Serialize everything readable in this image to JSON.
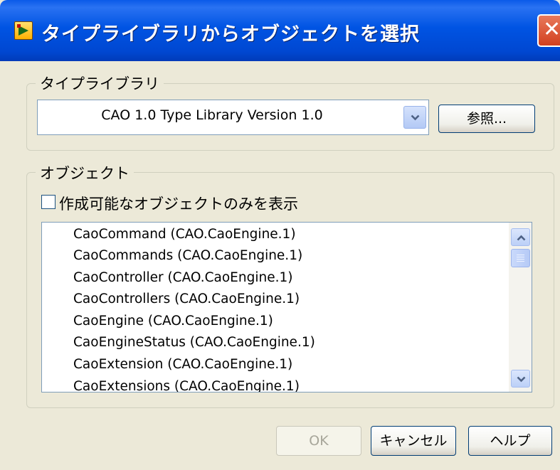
{
  "window": {
    "title": "タイプライブラリからオブジェクトを選択"
  },
  "type_library": {
    "group_label": "タイプライブラリ",
    "selected": "CAO 1.0 Type Library Version 1.0",
    "browse_label": "参照..."
  },
  "objects": {
    "group_label": "オブジェクト",
    "checkbox_label": "作成可能なオブジェクトのみを表示",
    "checkbox_checked": false,
    "items": [
      "CaoCommand (CAO.CaoEngine.1)",
      "CaoCommands (CAO.CaoEngine.1)",
      "CaoController (CAO.CaoEngine.1)",
      "CaoControllers (CAO.CaoEngine.1)",
      "CaoEngine (CAO.CaoEngine.1)",
      "CaoEngineStatus (CAO.CaoEngine.1)",
      "CaoExtension (CAO.CaoEngine.1)",
      "CaoExtensions (CAO.CaoEngine.1)"
    ]
  },
  "buttons": {
    "ok": "OK",
    "cancel": "キャンセル",
    "help": "ヘルプ"
  },
  "colors": {
    "titlebar": "#0054e3",
    "dialog_bg": "#ece9d8",
    "close": "#d2401f"
  },
  "icons": [
    "app-icon",
    "close-icon",
    "dropdown-arrow-icon",
    "scroll-up-icon",
    "scroll-down-icon"
  ]
}
